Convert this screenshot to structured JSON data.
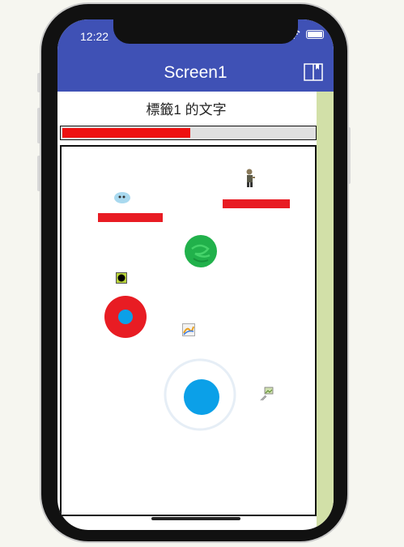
{
  "status": {
    "time": "12:22"
  },
  "appbar": {
    "title": "Screen1"
  },
  "label": {
    "text": "標籤1 的文字"
  },
  "progress": {
    "value": 0.51
  },
  "colors": {
    "appbar": "#3f51b5",
    "progress_fill": "#ee1111",
    "paddle": "#e81c23",
    "green_ball": "#21b14b",
    "joystick": "#0ba0e8",
    "side_strip": "#d2e0a8"
  },
  "icons": [
    "wifi-icon",
    "battery-icon",
    "book-icon",
    "bubble-sprite",
    "zombie-sprite",
    "green-ball-sprite",
    "black-ball-sprite",
    "red-ring-sprite",
    "image-sprite-icon",
    "broken-image-icon",
    "joystick"
  ]
}
